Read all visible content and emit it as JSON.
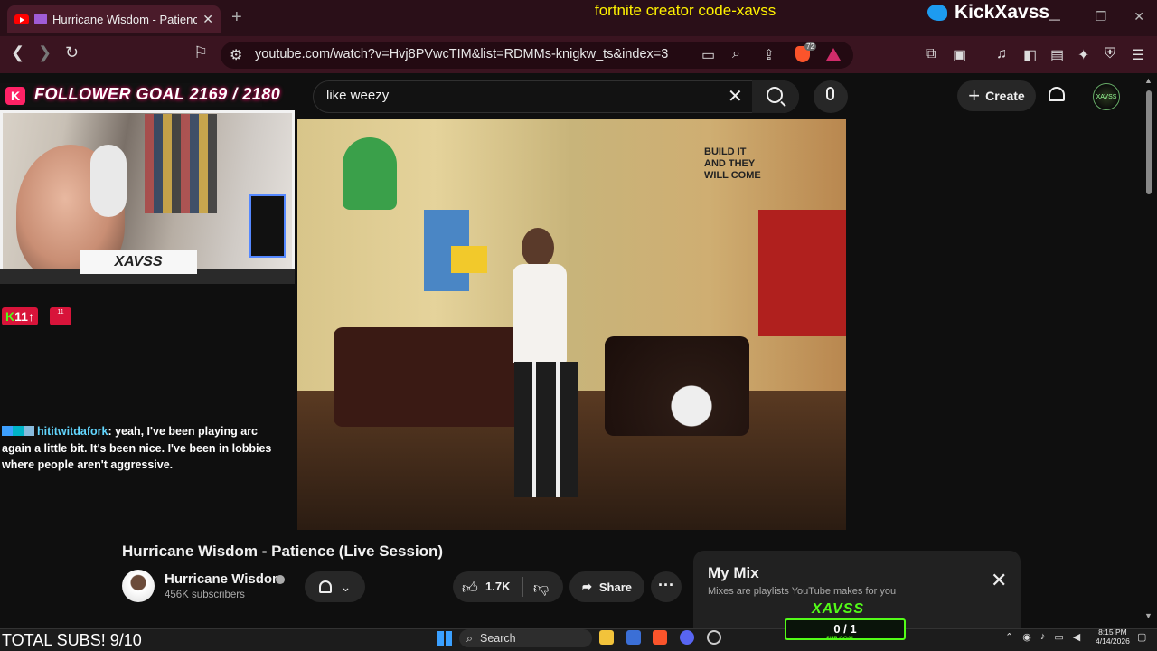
{
  "browser": {
    "tab_title": "Hurricane Wisdom - Patience",
    "url": "youtube.com/watch?v=Hvj8PVwcTIM&list=RDMMs-knigkw_ts&index=3",
    "brave_shield_count": "72"
  },
  "stream_overlay": {
    "creator_code": "fortnite creator code-xavss",
    "twitter_handle": "KickXavss_",
    "follower_goal": "FOLLOWER GOAL 2169 / 2180",
    "cam_nameplate": "XAVSS",
    "kick_badge": "11",
    "kick_badge_2": "11",
    "chat": {
      "username": "hititwitdafork",
      "message": ": yeah, I've been playing arc again a little bit. It's been nice. I've been in lobbies where people aren't aggressive."
    },
    "total_subs": "TOTAL SUBS! 9/10",
    "sub_goal_brand": "XAVSS",
    "sub_goal_value": "0 / 1",
    "sub_goal_label": "SUB GOAL"
  },
  "youtube": {
    "search_query": "like weezy",
    "create_label": "Create",
    "avatar_text": "XAVSS",
    "video_title": "Hurricane Wisdom - Patience (Live Session)",
    "channel_name": "Hurricane Wisdom",
    "subscriber_count": "456K subscribers",
    "like_count": "1.7K",
    "share_label": "Share",
    "mix_title": "My Mix",
    "mix_subtitle": "Mixes are playlists YouTube makes for you"
  },
  "video_wall_text": "BUILD IT AND THEY WILL COME",
  "taskbar": {
    "search_label": "Search",
    "time": "8:15 PM",
    "date": "4/14/2026"
  },
  "colors": {
    "tab_strip": "#2a0f18",
    "kick_green": "#53fc18",
    "youtube_bg": "#0f0f0f"
  }
}
